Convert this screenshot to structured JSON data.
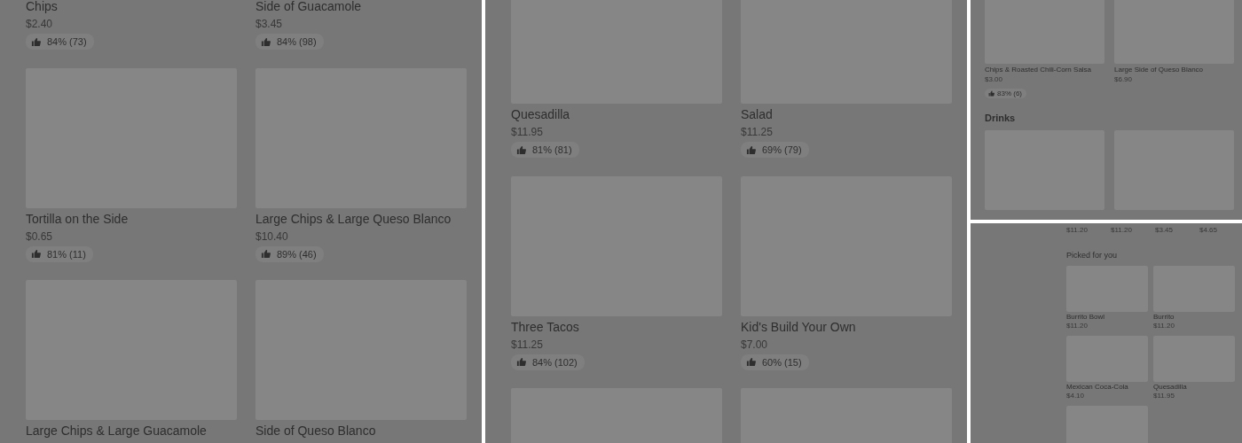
{
  "panels": [
    {
      "kind": "large",
      "sections": [
        {
          "kind": "grid2",
          "items": [
            {
              "kind": "listing",
              "name": "Chips",
              "price": "$2.40",
              "rating": "84% (73)"
            },
            {
              "kind": "listing",
              "name": "Side of Guacamole",
              "price": "$3.45",
              "rating": "84% (98)"
            },
            {
              "kind": "product",
              "name": "Tortilla on the Side",
              "price": "$0.65",
              "rating": "81% (11)"
            },
            {
              "kind": "product",
              "name": "Large Chips & Large Queso Blanco",
              "price": "$10.40",
              "rating": "89% (46)"
            },
            {
              "kind": "product",
              "name": "Large Chips & Large Guacamole"
            },
            {
              "kind": "product",
              "name": "Side of Queso Blanco"
            }
          ]
        }
      ]
    },
    {
      "kind": "large",
      "sections": [
        {
          "kind": "grid2",
          "items": [
            {
              "kind": "product",
              "name": "Quesadilla",
              "price": "$11.95",
              "rating": "81% (81)"
            },
            {
              "kind": "product",
              "name": "Salad",
              "price": "$11.25",
              "rating": "69% (79)"
            },
            {
              "kind": "product",
              "name": "Three Tacos",
              "price": "$11.25",
              "rating": "84% (102)"
            },
            {
              "kind": "product",
              "name": "Kid's Build Your Own",
              "price": "$7.00",
              "rating": "60% (15)"
            },
            {
              "kind": "tile"
            },
            {
              "kind": "tile"
            }
          ]
        }
      ]
    },
    {
      "kind": "medium",
      "sections": [
        {
          "kind": "grid2",
          "items": [
            {
              "kind": "product",
              "name": "Chips & Roasted Chili-Corn Salsa",
              "price": "$3.00",
              "rating": "83% (6)"
            },
            {
              "kind": "product",
              "name": "Large Side of Queso Blanco",
              "price": "$6.90"
            }
          ]
        },
        {
          "kind": "grid2",
          "title": "Drinks",
          "items": [
            {
              "kind": "tile"
            },
            {
              "kind": "tile"
            }
          ]
        }
      ]
    },
    {
      "kind": "small",
      "sections": [
        {
          "kind": "grid4",
          "items": [
            {
              "kind": "price",
              "price": "$11.20"
            },
            {
              "kind": "price",
              "price": "$11.20"
            },
            {
              "kind": "price",
              "price": "$3.45"
            },
            {
              "kind": "price",
              "price": "$4.65"
            }
          ]
        },
        {
          "kind": "grid2",
          "title": "Picked for you",
          "items": [
            {
              "kind": "product",
              "name": "Burrito Bowl",
              "price": "$11.20"
            },
            {
              "kind": "product",
              "name": "Burrito",
              "price": "$11.20"
            },
            {
              "kind": "product",
              "name": "Mexican Coca-Cola",
              "price": "$4.10"
            },
            {
              "kind": "product",
              "name": "Quesadilla",
              "price": "$11.95"
            },
            {
              "kind": "tile"
            }
          ]
        }
      ]
    }
  ]
}
